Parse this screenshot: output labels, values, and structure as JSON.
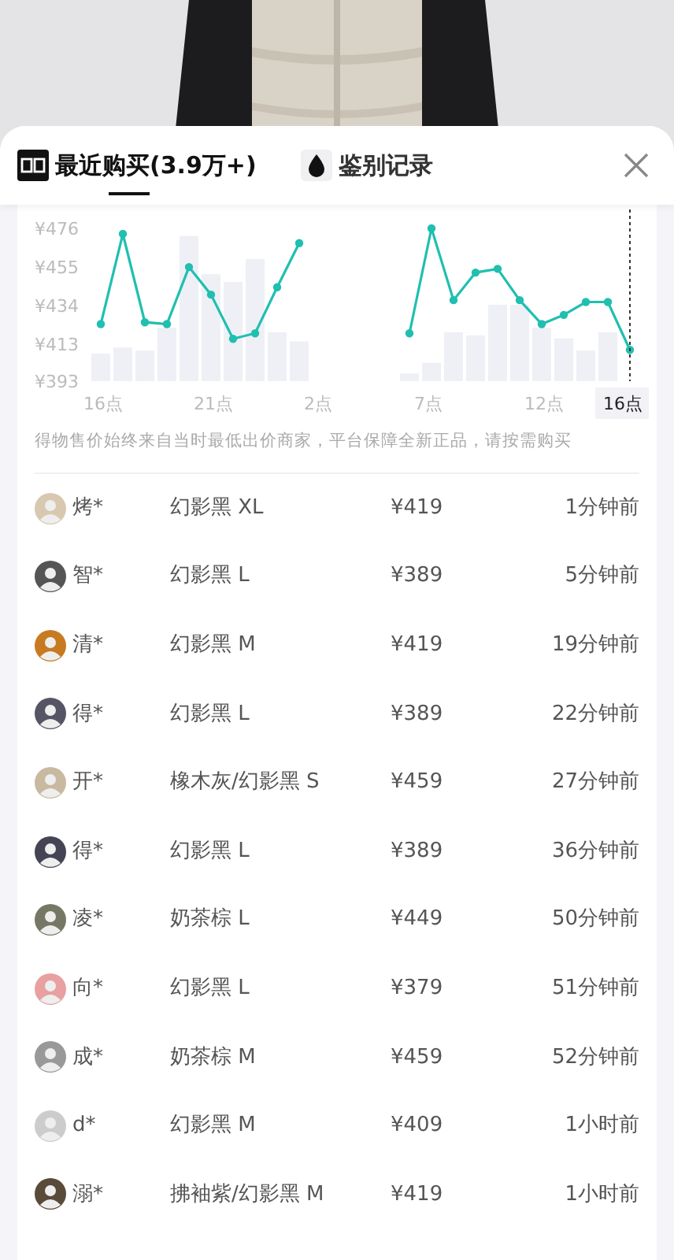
{
  "tabs": [
    {
      "label": "最近购买(3.9万+)",
      "kind": "logo",
      "selected": true
    },
    {
      "label": "鉴别记录",
      "kind": "drop",
      "selected": false
    }
  ],
  "chart_data": {
    "type": "line",
    "categories": [
      "16点",
      null,
      null,
      null,
      null,
      "21点",
      null,
      null,
      null,
      null,
      "2点",
      null,
      null,
      null,
      null,
      "7点",
      null,
      null,
      null,
      null,
      "12点",
      null,
      null,
      null,
      "16点"
    ],
    "series": [
      {
        "color": "#20bfb0",
        "marker": "circle",
        "values": [
          424,
          473,
          425,
          424,
          455,
          440,
          416,
          419,
          444,
          468,
          null,
          null,
          null,
          null,
          419,
          476,
          437,
          452,
          454,
          437,
          424,
          429,
          436,
          436,
          410
        ]
      }
    ],
    "ylim": [
      393,
      476
    ],
    "yticks": [
      {
        "value": 476,
        "label": "¥476"
      },
      {
        "value": 455,
        "label": "¥455"
      },
      {
        "value": 434,
        "label": "¥434"
      },
      {
        "value": 413,
        "label": "¥413"
      },
      {
        "value": 393,
        "label": "¥393"
      }
    ]
  },
  "note": "得物售价始终来自当时最低出价商家，平台保障全新正品，请按需购买",
  "rows": [
    {
      "user": "烤*",
      "variant": "幻影黑 XL",
      "price": "¥419",
      "time": "1分钟前"
    },
    {
      "user": "智*",
      "variant": "幻影黑 L",
      "price": "¥389",
      "time": "5分钟前"
    },
    {
      "user": "清*",
      "variant": "幻影黑 M",
      "price": "¥419",
      "time": "19分钟前"
    },
    {
      "user": "得*",
      "variant": "幻影黑 L",
      "price": "¥389",
      "time": "22分钟前"
    },
    {
      "user": "开*",
      "variant": "橡木灰/幻影黑 S",
      "price": "¥459",
      "time": "27分钟前"
    },
    {
      "user": "得*",
      "variant": "幻影黑 L",
      "price": "¥389",
      "time": "36分钟前"
    },
    {
      "user": "凌*",
      "variant": "奶茶棕 L",
      "price": "¥449",
      "time": "50分钟前"
    },
    {
      "user": "向*",
      "variant": "幻影黑 L",
      "price": "¥379",
      "time": "51分钟前"
    },
    {
      "user": "成*",
      "variant": "奶茶棕 M",
      "price": "¥459",
      "time": "52分钟前"
    },
    {
      "user": "d*",
      "variant": "幻影黑 M",
      "price": "¥409",
      "time": "1小时前"
    },
    {
      "user": "溺*",
      "variant": "拂袖紫/幻影黑 M",
      "price": "¥419",
      "time": "1小时前"
    }
  ]
}
